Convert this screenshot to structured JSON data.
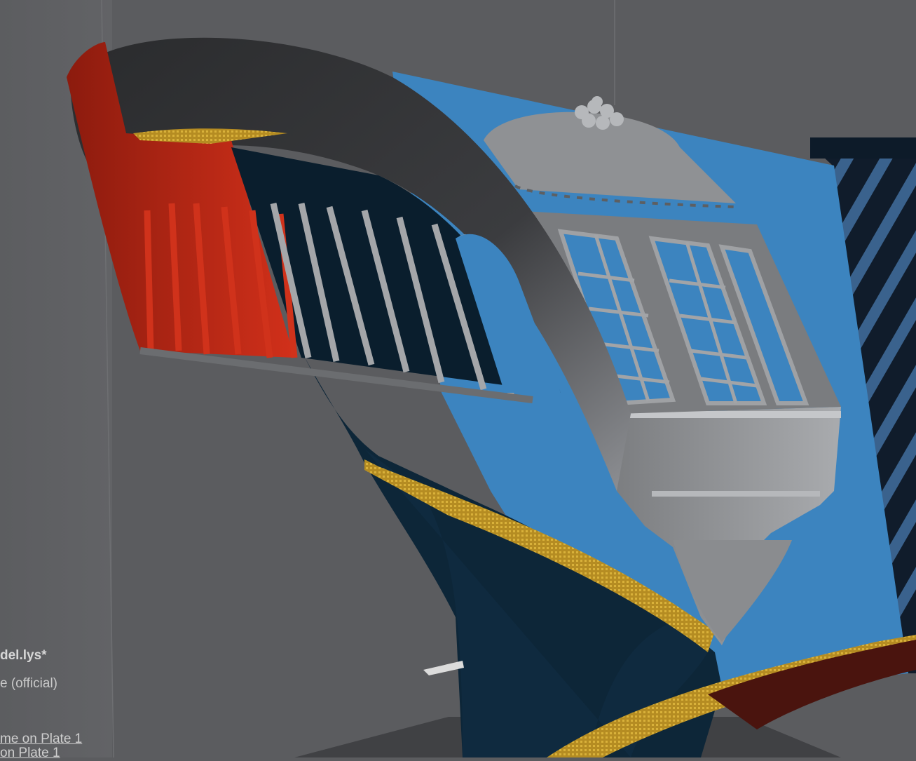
{
  "viewport": {
    "scene": "stern of sailing ship model",
    "colors": {
      "background": "#5b5c5f",
      "wall_left": "#5e5f62",
      "wall_right": "#626366",
      "hull_dark": "#0e2638",
      "hull_blue": "#3d86c0",
      "gallery_gray": "#6f7174",
      "overhang_red": "#b32414",
      "stripe_yellow": "#c9a12a"
    }
  },
  "info": {
    "file_name": "del.lys*",
    "profile": "e (official)",
    "plate_item_1": "me on Plate 1",
    "plate_item_2": "on Plate 1"
  }
}
